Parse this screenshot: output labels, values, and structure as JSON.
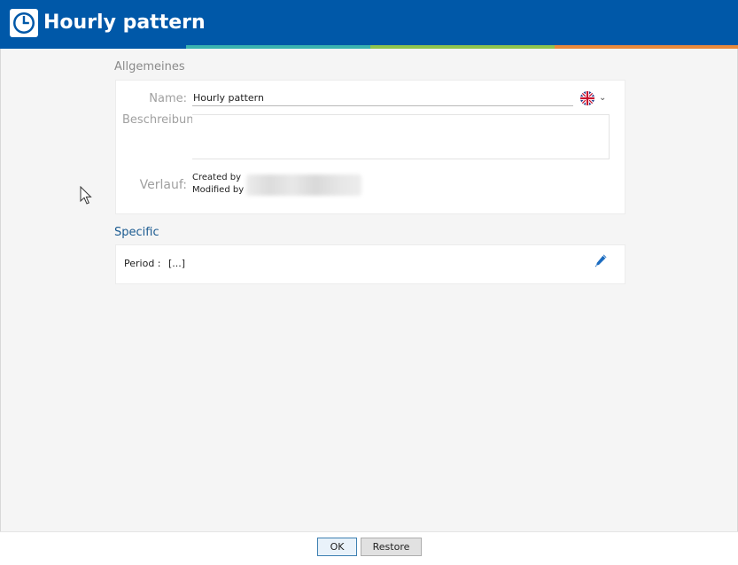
{
  "header": {
    "title": "Hourly pattern",
    "icon": "clock-icon",
    "background": "#0058a8",
    "accent_colors": [
      "#0058a8",
      "#3ab3b0",
      "#8ec44e",
      "#e98a3c"
    ]
  },
  "general": {
    "section_title": "Allgemeines",
    "name_label": "Name:",
    "name_value": "Hourly pattern",
    "language_icon": "uk-flag-icon",
    "description_label": "Beschreibung:",
    "description_value": "",
    "history_label": "Verlauf:",
    "created_by_label": "Created by",
    "modified_by_label": "Modified by"
  },
  "specific": {
    "section_title": "Specific",
    "period_label": "Period :",
    "period_value": "[...]",
    "edit_icon": "pencil-icon"
  },
  "footer": {
    "ok_label": "OK",
    "restore_label": "Restore"
  }
}
